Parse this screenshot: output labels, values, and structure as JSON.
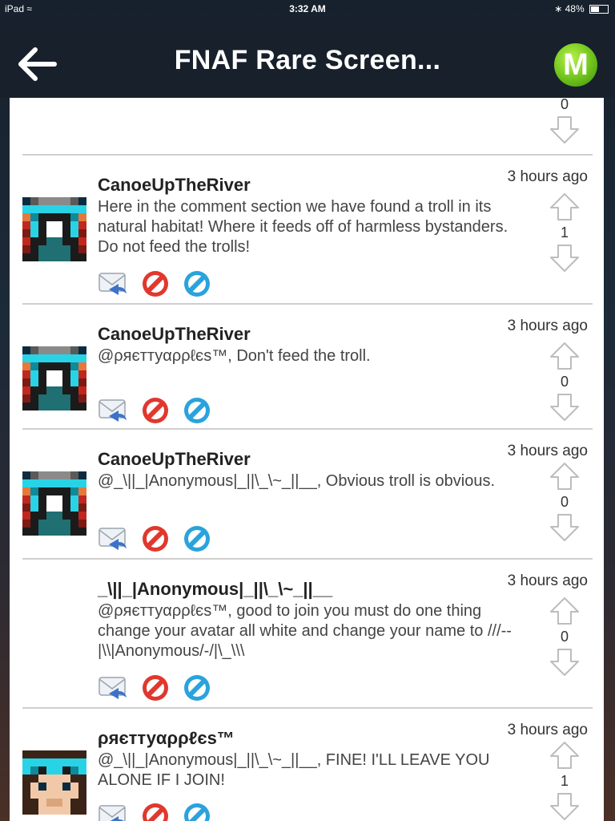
{
  "status_bar": {
    "device": "iPad",
    "time": "3:32 AM",
    "battery": "48%",
    "battery_level": 0.48
  },
  "header": {
    "title": "FNAF Rare Screen...",
    "logo_letter": "M",
    "back_icon": "back-arrow-icon"
  },
  "icons": {
    "reply": "reply-mail-icon",
    "flag": "flag-prohibited-icon",
    "block": "block-icon",
    "upvote": "upvote-arrow-icon",
    "downvote": "downvote-arrow-icon"
  },
  "colors": {
    "header_bg": "#17202b",
    "flag_red": "#e0382e",
    "block_blue": "#2aa3dc",
    "logo_green": "#6ec21b"
  },
  "comments": [
    {
      "author": "",
      "time": "",
      "text": "",
      "score": "0"
    },
    {
      "author": "CanoeUpTheRiver",
      "time": "3 hours ago",
      "text": "Here in the comment section we have found a troll in its natural habitat! Where it feeds off of harmless bystanders. Do not feed the trolls!",
      "score": "1"
    },
    {
      "author": "CanoeUpTheRiver",
      "time": "3 hours ago",
      "text": "@ρяєттуαρρℓєѕ™, Don't feed the troll.",
      "score": "0"
    },
    {
      "author": "CanoeUpTheRiver",
      "time": "3 hours ago",
      "text": "@_\\||_|Anonymous|_||\\_\\~_||__, Obvious troll is obvious.",
      "score": "0"
    },
    {
      "author": "_\\||_|Anonymous|_||\\_\\~_||__",
      "time": "3 hours ago",
      "text": "@ρяєттуαρρℓєѕ™, good to join you must do one thing change your avatar all white and change your name to ///--|\\\\|Anonymous/-/|\\_\\\\\\",
      "score": "0"
    },
    {
      "author": "ρяєттуαρρℓєѕ™",
      "time": "3 hours ago",
      "text": "@_\\||_|Anonymous|_||\\_\\~_||__, FINE! I'LL LEAVE YOU ALONE IF I JOIN!",
      "score": "1"
    }
  ]
}
